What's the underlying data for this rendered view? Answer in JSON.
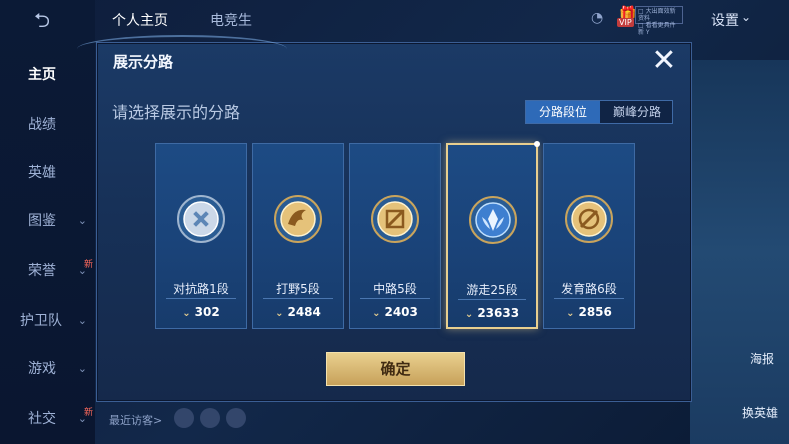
{
  "app": {
    "top_tabs": [
      "个人主页",
      "电竞生"
    ],
    "settings_label": "设置",
    "settings_chevron": "chevron-down",
    "vip_text": "VIP",
    "vip_box_lines": [
      "□ 大出面效新资料",
      "□ 看看更具件新 Y"
    ]
  },
  "left_nav": {
    "items": [
      {
        "label": "主页",
        "active": true,
        "chevron": false,
        "new": false
      },
      {
        "label": "战绩",
        "active": false,
        "chevron": false,
        "new": false
      },
      {
        "label": "英雄",
        "active": false,
        "chevron": false,
        "new": false
      },
      {
        "label": "图鉴",
        "active": false,
        "chevron": true,
        "new": false
      },
      {
        "label": "荣誉",
        "active": false,
        "chevron": true,
        "new": true
      },
      {
        "label": "护卫队",
        "active": false,
        "chevron": true,
        "new": false
      },
      {
        "label": "游戏",
        "active": false,
        "chevron": true,
        "new": false
      },
      {
        "label": "社交",
        "active": false,
        "chevron": true,
        "new": true
      }
    ],
    "new_marker": "新"
  },
  "right_panel": {
    "labels": [
      "海报",
      "换英雄"
    ]
  },
  "bottom": {
    "recent_visitors": "最近访客>"
  },
  "dialog": {
    "title": "展示分路",
    "subtitle": "请选择展示的分路",
    "close_icon": "close-icon",
    "toggle": {
      "options": [
        "分路段位",
        "巅峰分路"
      ],
      "selected": 0
    },
    "cards": [
      {
        "label": "对抗路1段",
        "score": "302",
        "emblem": "silver-cross",
        "selected": false
      },
      {
        "label": "打野5段",
        "score": "2484",
        "emblem": "gold-dragon",
        "selected": false
      },
      {
        "label": "中路5段",
        "score": "2403",
        "emblem": "gold-slash",
        "selected": false
      },
      {
        "label": "游走25段",
        "score": "23633",
        "emblem": "blue-wings",
        "selected": true
      },
      {
        "label": "发育路6段",
        "score": "2856",
        "emblem": "gold-arrows",
        "selected": false
      }
    ],
    "confirm_label": "确定"
  },
  "colors": {
    "accent_gold": "#e8cf8f",
    "dialog_bg": "#173158",
    "toggle_active": "#2e6ab8"
  }
}
